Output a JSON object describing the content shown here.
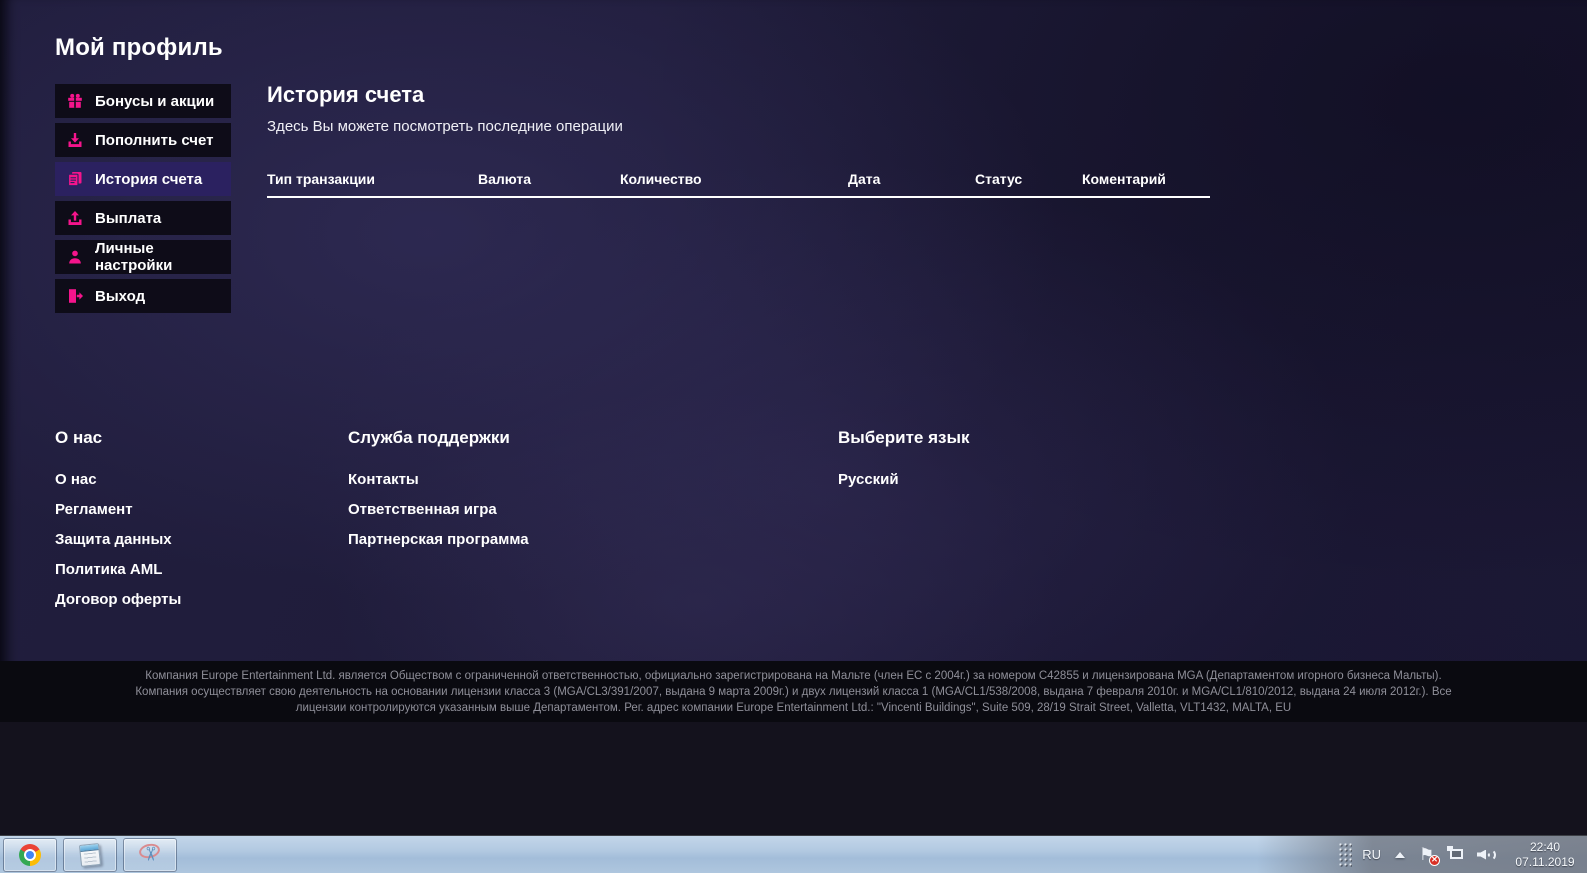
{
  "page": {
    "title": "Мой профиль"
  },
  "sidebar": {
    "items": [
      {
        "label": "Бонусы и акции",
        "icon": "gift-icon",
        "active": false
      },
      {
        "label": "Пополнить счет",
        "icon": "deposit-icon",
        "active": false
      },
      {
        "label": "История счета",
        "icon": "history-icon",
        "active": true
      },
      {
        "label": "Выплата",
        "icon": "payout-icon",
        "active": false
      },
      {
        "label": "Личные настройки",
        "icon": "person-icon",
        "active": false
      },
      {
        "label": "Выход",
        "icon": "exit-icon",
        "active": false
      }
    ]
  },
  "main": {
    "title": "История счета",
    "subtitle": "Здесь Вы можете посмотреть последние операции",
    "table": {
      "headers": [
        "Тип транзакции",
        "Валюта",
        "Количество",
        "Дата",
        "Статус",
        "Коментарий"
      ],
      "rows": []
    }
  },
  "footer": {
    "columns": [
      {
        "heading": "О нас",
        "links": [
          "О нас",
          "Регламент",
          "Защита данных",
          "Политика AML",
          "Договор оферты"
        ]
      },
      {
        "heading": "Служба поддержки",
        "links": [
          "Контакты",
          "Ответственная игра",
          "Партнерская программа"
        ]
      },
      {
        "heading": "Выберите язык",
        "links": [
          "Русский"
        ]
      }
    ],
    "legal_lines": [
      "Компания Europe Entertainment Ltd. является Обществом с ограниченной ответственностью, официально зарегистрирована на Мальте (член ЕС с 2004г.) за номером C42855 и лицензирована MGA (Департаментом игорного бизнеса Мальты).",
      "Компания осуществляет свою деятельность на основании лицензии класса 3 (MGA/CL3/391/2007, выдана 9 марта 2009г.) и двух лицензий класса 1 (MGA/CL1/538/2008, выдана 7 февраля 2010г. и MGA/CL1/810/2012, выдана 24 июля 2012г.). Все",
      "лицензии контролируются указанным выше Департаментом. Рег. адрес компании Europe Entertainment Ltd.: \"Vincenti Buildings\", Suite 509, 28/19 Strait Street, Valletta, VLT1432, MALTA, EU"
    ]
  },
  "taskbar": {
    "apps": [
      {
        "name": "chrome",
        "icon": "chrome-icon"
      },
      {
        "name": "notepad",
        "icon": "notepad-icon"
      },
      {
        "name": "snipping-tool",
        "icon": "snipping-tool-icon"
      }
    ],
    "tray": {
      "language": "RU",
      "time": "22:40",
      "date": "07.11.2019"
    }
  },
  "colors": {
    "accent_pink": "#f5148c",
    "sidebar_item_bg": "#0e0c18",
    "active_item_bg": "#2b2160",
    "page_bg": "#1f1c38",
    "legal_bg": "#0a0a10",
    "taskbar_blue": "#b2c9e1"
  }
}
